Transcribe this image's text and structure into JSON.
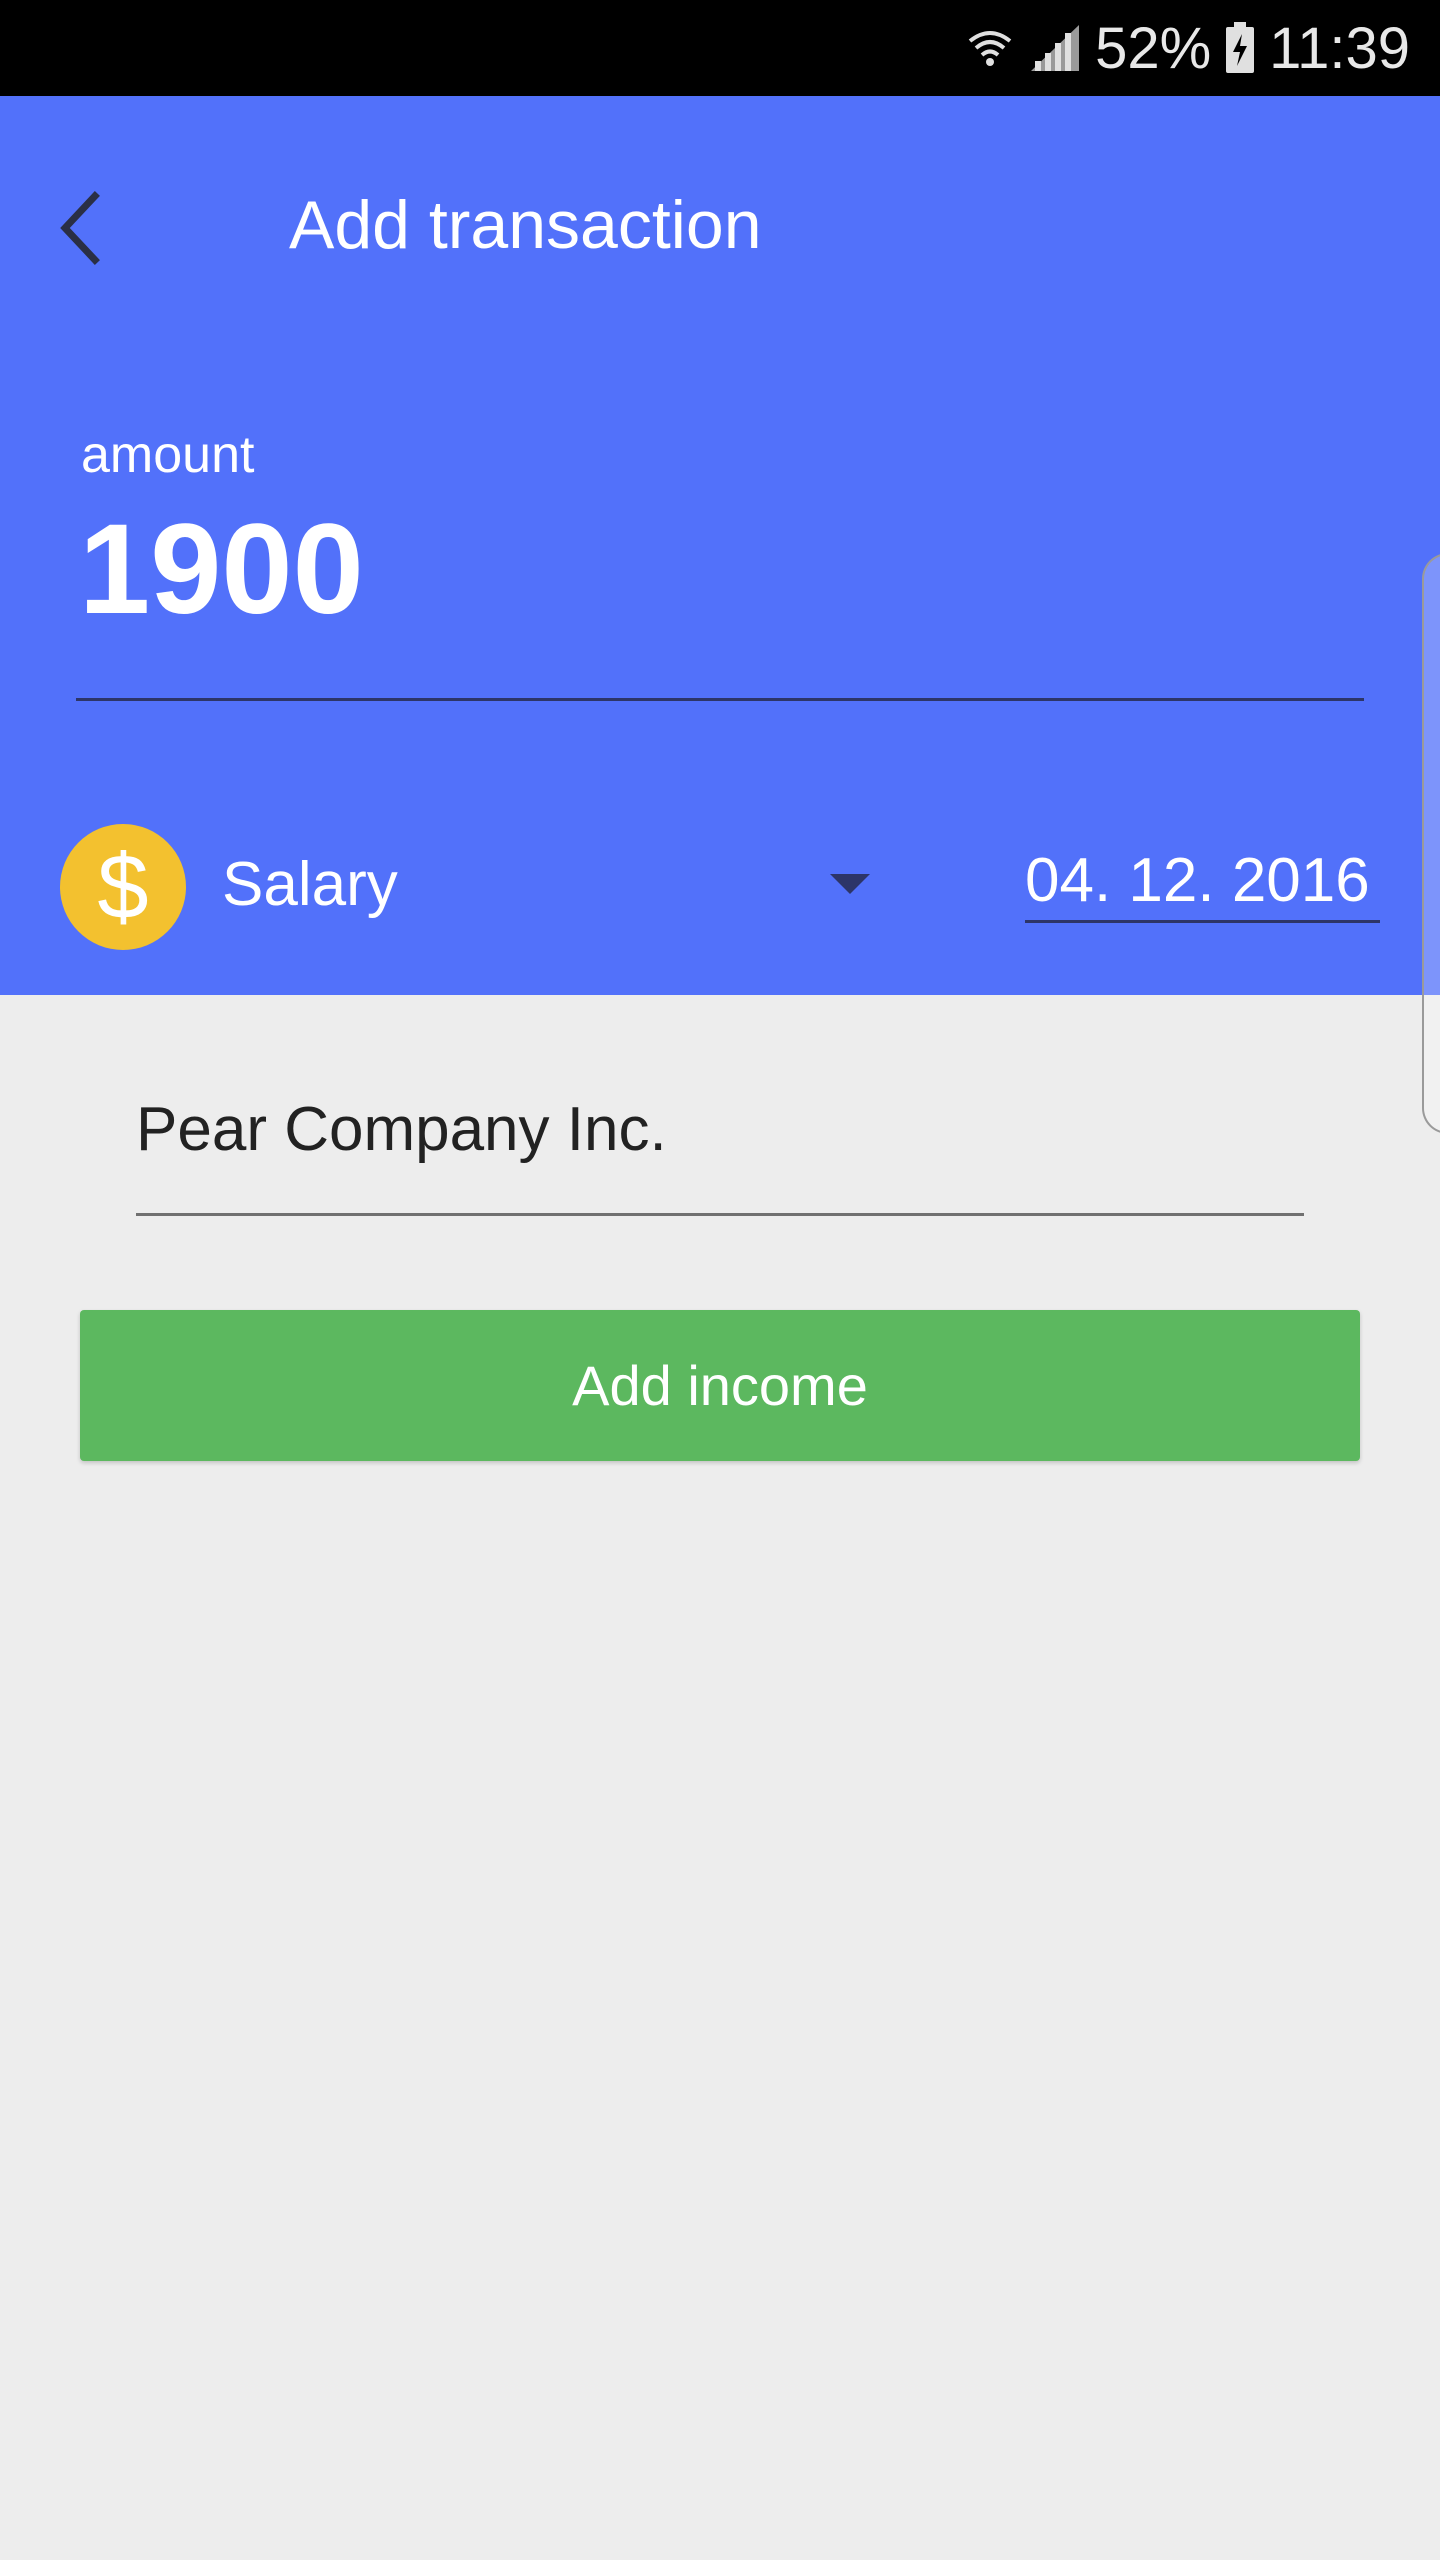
{
  "status_bar": {
    "battery": "52%",
    "time": "11:39",
    "icons": [
      "wifi-icon",
      "signal-icon",
      "battery-charging-icon"
    ]
  },
  "header": {
    "title": "Add transaction",
    "back_icon": "chevron-left-icon"
  },
  "amount": {
    "label": "amount",
    "value": "1900"
  },
  "category": {
    "icon": "dollar-coin-icon",
    "icon_glyph": "$",
    "label": "Salary"
  },
  "date": {
    "value": "04. 12. 2016"
  },
  "description": {
    "value": "Pear Company Inc."
  },
  "actions": {
    "add_income_label": "Add income"
  },
  "colors": {
    "header_bg": "#5271fa",
    "button_green": "#5cb85f",
    "coin_yellow": "#f3c12f",
    "page_bg": "#ededed"
  }
}
